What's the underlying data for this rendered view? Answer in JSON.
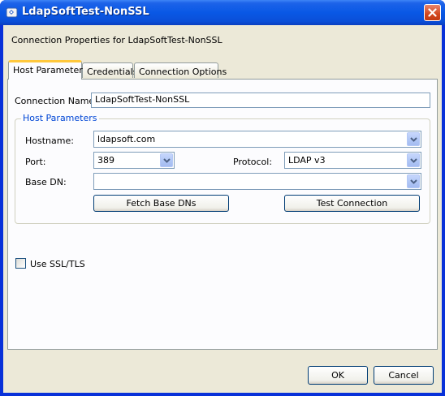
{
  "window": {
    "title": "LdapSoftTest-NonSSL",
    "close_glyph": "✕"
  },
  "header": {
    "text": "Connection Properties for LdapSoftTest-NonSSL"
  },
  "tabs": [
    {
      "label": "Host Parameter",
      "active": true
    },
    {
      "label": "Credentials",
      "active": false
    },
    {
      "label": "Connection Options",
      "active": false
    }
  ],
  "form": {
    "connection_name_label": "Connection Name:",
    "connection_name_value": "LdapSoftTest-NonSSL",
    "group_title": "Host Parameters",
    "hostname_label": "Hostname:",
    "hostname_value": "ldapsoft.com",
    "port_label": "Port:",
    "port_value": "389",
    "protocol_label": "Protocol:",
    "protocol_value": "LDAP v3",
    "base_dn_label": "Base DN:",
    "base_dn_value": "",
    "fetch_button": "Fetch Base DNs",
    "test_button": "Test Connection",
    "ssl_label": "Use SSL/TLS",
    "ssl_checked": false
  },
  "footer": {
    "ok_label": "OK",
    "cancel_label": "Cancel"
  },
  "colors": {
    "title_bar": "#0a4fd8",
    "dialog_bg": "#ece9d8",
    "panel_bg": "#fcfcfe",
    "group_title": "#0046d5",
    "active_tab_accent": "#ffc83c"
  }
}
